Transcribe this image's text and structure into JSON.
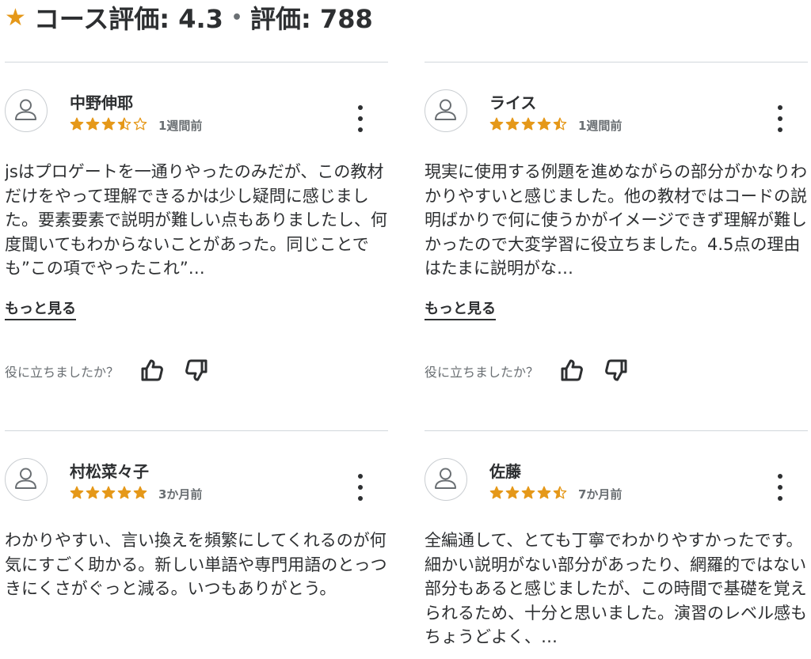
{
  "header": {
    "rating_label": "コース評価: 4.3",
    "count_label": "評価: 788",
    "separator": "•"
  },
  "helpful_prompt": "役に立ちましたか？",
  "more_label": "もっと見る",
  "colors": {
    "star": "#e59819",
    "text": "#2d2f31",
    "muted": "#6a6f73",
    "divider": "#d1d7dc"
  },
  "reviews": [
    {
      "name": "中野伸耶",
      "rating": 3.5,
      "date": "1週間前",
      "text": "jsはプロゲートを一通りやったのみだが、この教材だけをやって理解できるかは少し疑問に感じました。要素要素で説明が難しい点もありましたし、何度聞いてもわからないことがあった。同じことでも”この項でやったこれ”…"
    },
    {
      "name": "ライス",
      "rating": 4.5,
      "date": "1週間前",
      "text": "現実に使用する例題を進めながらの部分がかなりわかりやすいと感じました。他の教材ではコードの説明ばかりで何に使うかがイメージできず理解が難しかったので大変学習に役立ちました。4.5点の理由はたまに説明がな…"
    },
    {
      "name": "村松菜々子",
      "rating": 5,
      "date": "3か月前",
      "text": "わかりやすい、言い換えを頻繁にしてくれるのが何気にすごく助かる。新しい単語や専門用語のとっつきにくさがぐっと減る。いつもありがとう。"
    },
    {
      "name": "佐藤",
      "rating": 4.5,
      "date": "7か月前",
      "text": "全編通して、とても丁寧でわかりやすかったです。細かい説明がない部分があったり、網羅的ではない部分もあると感じましたが、この時間で基礎を覚えられるため、十分と思いました。演習のレベル感もちょうどよく、…"
    }
  ]
}
